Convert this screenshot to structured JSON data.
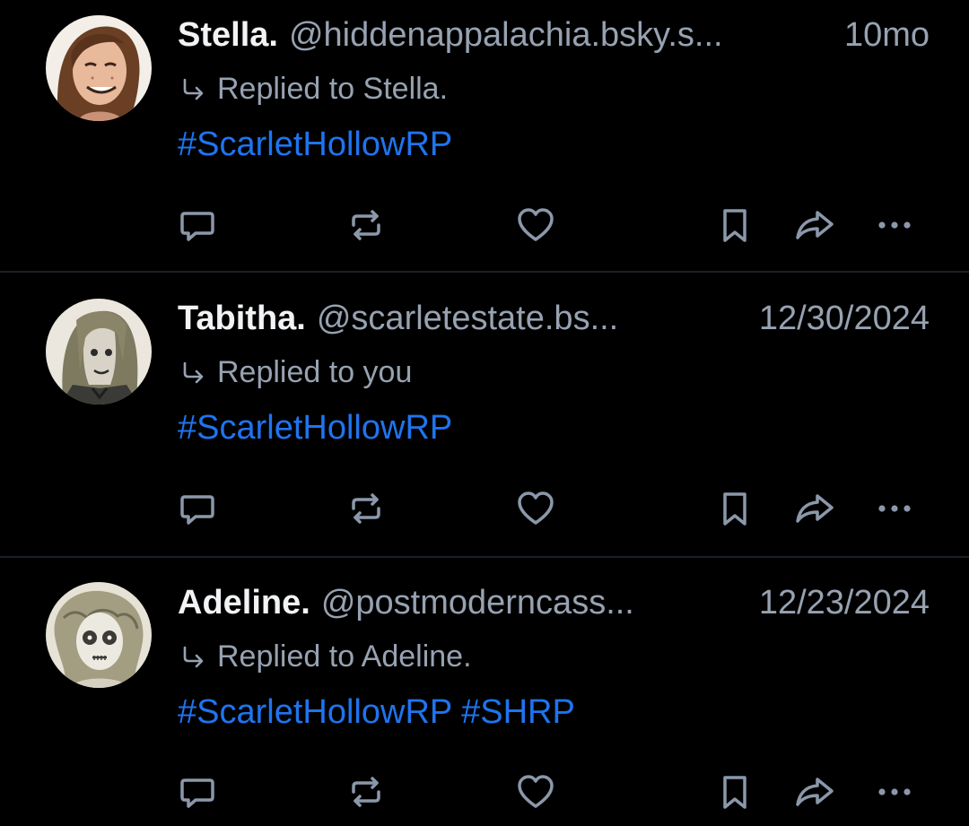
{
  "posts": [
    {
      "author": "Stella.",
      "handle": "@hiddenappalachia.bsky.s...",
      "time": "10mo",
      "reply_to": "Replied to Stella.",
      "tags": [
        "#ScarletHollowRP"
      ]
    },
    {
      "author": "Tabitha.",
      "handle": "@scarletestate.bs...",
      "time": "12/30/2024",
      "reply_to": "Replied to you",
      "tags": [
        "#ScarletHollowRP"
      ]
    },
    {
      "author": "Adeline.",
      "handle": "@postmoderncass...",
      "time": "12/23/2024",
      "reply_to": "Replied to Adeline.",
      "tags": [
        "#ScarletHollowRP",
        "#SHRP"
      ]
    }
  ],
  "actions": {
    "icons": [
      "reply-icon",
      "repost-icon",
      "like-icon",
      "bookmark-icon",
      "share-icon",
      "more-icon"
    ]
  },
  "colors": {
    "background": "#000000",
    "name": "#f1f3f5",
    "muted": "#97a2b1",
    "hashtag": "#1f74ef",
    "icon": "#8b98aa",
    "divider": "#1c2027"
  }
}
